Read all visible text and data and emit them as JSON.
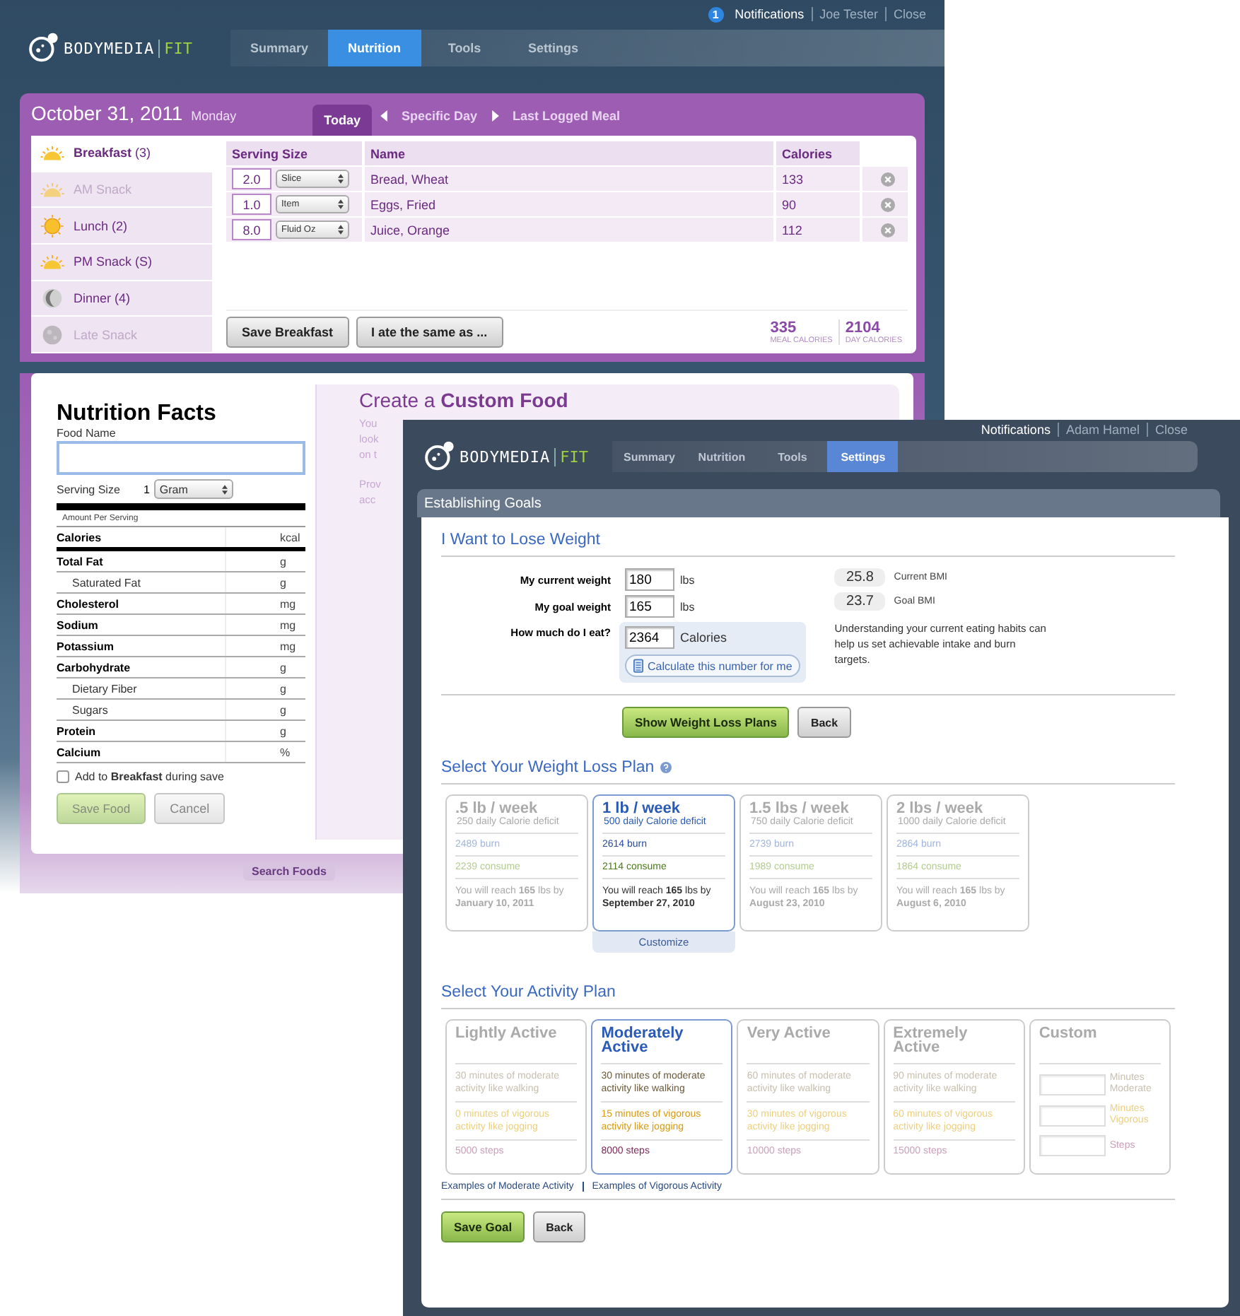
{
  "back_window": {
    "top_links": {
      "notification_count": "1",
      "notifications": "Notifications",
      "user": "Joe Tester",
      "close": "Close"
    },
    "logo": {
      "brand": "BODYMEDIA",
      "product": "FIT"
    },
    "nav_tabs": [
      {
        "label": "Summary",
        "selected": false
      },
      {
        "label": "Nutrition",
        "selected": true
      },
      {
        "label": "Tools",
        "selected": false
      },
      {
        "label": "Settings",
        "selected": false
      }
    ],
    "date": "October 31, 2011",
    "weekday": "Monday",
    "day_tabs": [
      {
        "label": "Today",
        "selected": true
      },
      {
        "label": "Specific Day",
        "selected": false
      },
      {
        "label": "Last Logged Meal",
        "selected": false
      }
    ],
    "meals": [
      {
        "label": "Breakfast",
        "count": "(3)",
        "kind": "half_sun",
        "selected": true,
        "disabled": false
      },
      {
        "label": "AM Snack",
        "kind": "half_sun",
        "selected": false,
        "disabled": true
      },
      {
        "label": "Lunch",
        "count": "(2)",
        "kind": "sun",
        "selected": false,
        "disabled": false
      },
      {
        "label": "PM Snack",
        "count": "(S)",
        "kind": "half_sun",
        "selected": false,
        "disabled": false
      },
      {
        "label": "Dinner",
        "count": "(4)",
        "kind": "crescent",
        "selected": false,
        "disabled": false
      },
      {
        "label": "Late Snack",
        "kind": "full_moon",
        "selected": false,
        "disabled": true
      }
    ],
    "food_table": {
      "columns": [
        "Serving Size",
        "Name",
        "Calories"
      ],
      "rows": [
        {
          "amount": "2.0",
          "unit": "Slice",
          "name": "Bread, Wheat",
          "calories": "133"
        },
        {
          "amount": "1.0",
          "unit": "Item",
          "name": "Eggs, Fried",
          "calories": "90"
        },
        {
          "amount": "8.0",
          "unit": "Fluid Oz",
          "name": "Juice, Orange",
          "calories": "112"
        }
      ]
    },
    "buttons": [
      "Save Breakfast",
      "I ate the same as ..."
    ],
    "totals": [
      {
        "value": "335",
        "label": "MEAL CALORIES"
      },
      {
        "value": "2104",
        "label": "DAY CALORIES"
      }
    ],
    "nutrition_facts": {
      "title": "Nutrition Facts",
      "food_name_label": "Food Name",
      "serving_label": "Serving Size",
      "serving_amount": "1",
      "serving_unit": "Gram",
      "amount_per_serving": "Amount Per Serving",
      "rows": [
        {
          "label": "Calories",
          "unit": "kcal",
          "kind": "calories"
        },
        {
          "label": "Total Fat",
          "unit": "g",
          "kind": "main"
        },
        {
          "label": "Saturated Fat",
          "unit": "g",
          "kind": "sub"
        },
        {
          "label": "Cholesterol",
          "unit": "mg",
          "kind": "main"
        },
        {
          "label": "Sodium",
          "unit": "mg",
          "kind": "main"
        },
        {
          "label": "Potassium",
          "unit": "mg",
          "kind": "main"
        },
        {
          "label": "Carbohydrate",
          "unit": "g",
          "kind": "main"
        },
        {
          "label": "Dietary Fiber",
          "unit": "g",
          "kind": "sub"
        },
        {
          "label": "Sugars",
          "unit": "g",
          "kind": "sub"
        },
        {
          "label": "Protein",
          "unit": "g",
          "kind": "main"
        },
        {
          "label": "Calcium",
          "unit": "%",
          "kind": "main"
        }
      ],
      "add_to": "Add to **Breakfast** during save",
      "add_checked": false,
      "save": "Save Food",
      "cancel": "Cancel"
    },
    "custom_food": {
      "title": "Create a **Custom Food**",
      "lines": [
        "You",
        "look",
        "on t"
      ],
      "lines_2": [
        "Prov",
        "acc"
      ]
    },
    "footer_button": "Search Foods"
  },
  "front_window": {
    "top_links": {
      "notifications": "Notifications",
      "user": "Adam Hamel",
      "close": "Close"
    },
    "logo": {
      "brand": "BODYMEDIA",
      "product": "FIT"
    },
    "nav_tabs": [
      {
        "label": "Summary",
        "selected": false
      },
      {
        "label": "Nutrition",
        "selected": false
      },
      {
        "label": "Tools",
        "selected": false
      },
      {
        "label": "Settings",
        "selected": true
      }
    ],
    "section_title": "Establishing Goals",
    "lose_heading": "I Want to Lose Weight",
    "fields": [
      {
        "label": "My current weight",
        "value": "180",
        "unit": "lbs"
      },
      {
        "label": "My goal weight",
        "value": "165",
        "unit": "lbs"
      }
    ],
    "bmi": [
      {
        "value": "25.8",
        "label": "Current BMI"
      },
      {
        "value": "23.7",
        "label": "Goal BMI"
      }
    ],
    "eat": {
      "label": "How much do I eat?",
      "value": "2364",
      "unit": "Calories",
      "calc_button": "Calculate this number for me"
    },
    "hint": "Understanding your current eating habits can help us set achievable intake and burn targets.",
    "buttons": [
      "Show Weight Loss Plans",
      "Back"
    ],
    "plans_heading": "Select Your Weight Loss Plan",
    "plans": [
      {
        "title": ".5 lb / week",
        "deficit": "250 daily Calorie deficit",
        "burn": "2489 burn",
        "consume": "2239 consume",
        "reach": "You will reach **165** lbs by",
        "date": "January 10, 2011",
        "selected": false
      },
      {
        "title": "1 lb / week",
        "deficit": "500 daily Calorie deficit",
        "burn": "2614 burn",
        "consume": "2114 consume",
        "reach": "You will reach **165** lbs by",
        "date": "September 27, 2010",
        "selected": true
      },
      {
        "title": "1.5 lbs / week",
        "deficit": "750 daily Calorie deficit",
        "burn": "2739 burn",
        "consume": "1989 consume",
        "reach": "You will reach **165** lbs by",
        "date": "August 23, 2010",
        "selected": false
      },
      {
        "title": "2 lbs / week",
        "deficit": "1000 daily Calorie deficit",
        "burn": "2864 burn",
        "consume": "1864 consume",
        "reach": "You will reach **165** lbs by",
        "date": "August 6, 2010",
        "selected": false
      }
    ],
    "customize": "Customize",
    "activity_heading": "Select Your Activity Plan",
    "activity": [
      {
        "kind": "preset",
        "title": "Lightly Active",
        "moderate": "30 minutes of moderate activity like walking",
        "vigorous": "0 minutes of vigorous activity like jogging",
        "steps": "5000 steps",
        "selected": false
      },
      {
        "kind": "preset",
        "title": "Moderately Active",
        "moderate": "30 minutes of moderate activity like walking",
        "vigorous": "15 minutes of vigorous activity like jogging",
        "steps": "8000 steps",
        "selected": true
      },
      {
        "kind": "preset",
        "title": "Very Active",
        "moderate": "60 minutes of moderate activity like walking",
        "vigorous": "30 minutes of vigorous activity like jogging",
        "steps": "10000 steps",
        "selected": false
      },
      {
        "kind": "preset",
        "title": "Extremely Active",
        "moderate": "90 minutes of moderate activity like walking",
        "vigorous": "60 minutes of vigorous activity like jogging",
        "steps": "15000 steps",
        "selected": false
      },
      {
        "kind": "custom",
        "title": "Custom",
        "moderate": "Minutes Moderate",
        "vigorous": "Minutes Vigorous",
        "steps": "Steps",
        "selected": false
      }
    ],
    "links": [
      "Examples of Moderate Activity",
      "Examples of Vigorous Activity"
    ],
    "final_buttons": [
      "Save Goal",
      "Back"
    ]
  }
}
